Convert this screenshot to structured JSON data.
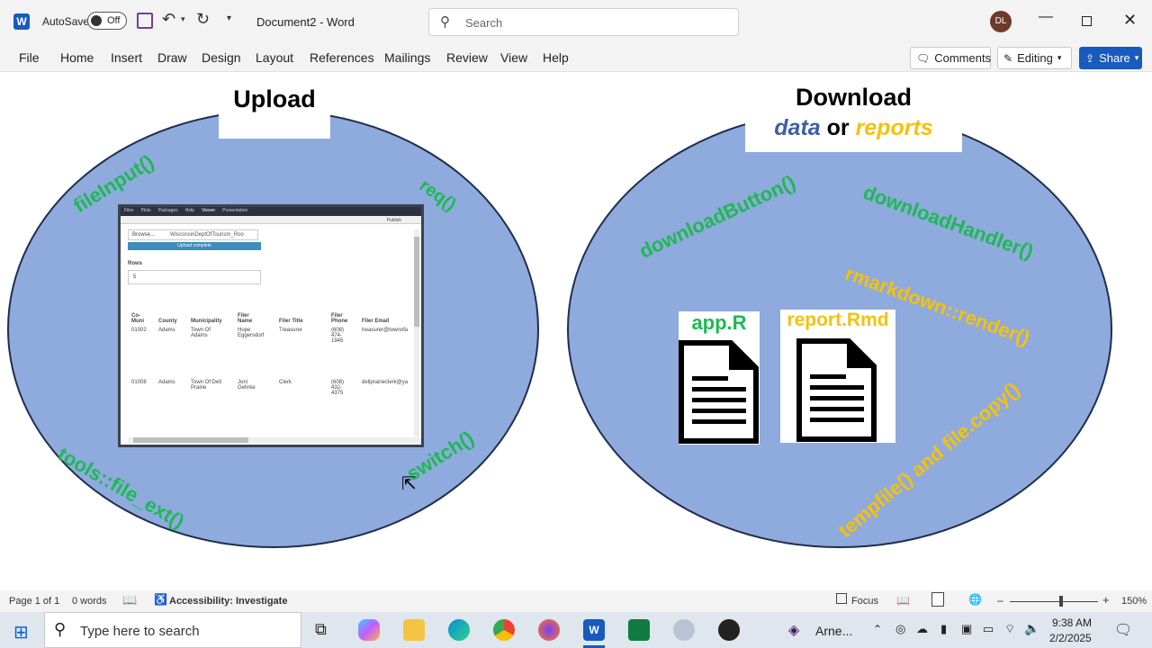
{
  "titlebar": {
    "app_badge": "W",
    "autosave_label": "AutoSave",
    "autosave_state": "Off",
    "doc_title": "Document2  -  Word",
    "search_placeholder": "Search",
    "user_initials": "DL"
  },
  "menu": {
    "items": [
      "File",
      "Home",
      "Insert",
      "Draw",
      "Design",
      "Layout",
      "References",
      "Mailings",
      "Review",
      "View",
      "Help"
    ],
    "comments_label": "Comments",
    "editing_label": "Editing",
    "share_label": "Share"
  },
  "slide": {
    "upload_title": "Upload",
    "download_title": "Download",
    "download_sub_data": "data",
    "download_sub_or": "or",
    "download_sub_reports": "reports",
    "upload_funcs": [
      "fileInput()",
      "req()",
      "tools::file_ext()",
      "switch()"
    ],
    "download_funcs": [
      "downloadButton()",
      "downloadHandler()",
      "rmarkdown::render()",
      "tempfile() and file.copy()"
    ],
    "file1_label": "app.R",
    "file2_label": "report.Rmd",
    "colors": {
      "green": "#1db954",
      "yellow": "#f4c20d",
      "ellipse_fill": "#8faadc",
      "data_blue": "#3b5ea8"
    }
  },
  "mini_app": {
    "tabs": [
      "Files",
      "Plots",
      "Packages",
      "Help",
      "Viewer",
      "Presentation"
    ],
    "publish_label": "Publish",
    "browse_label": "Browse...",
    "file_name": "WisconsinDeptOfTourism_Roo",
    "progress_label": "Upload complete",
    "progress_fraction": 1.0,
    "rows_label": "Rows",
    "rows_value": "5",
    "headers": [
      "Co-\nMuni",
      "County",
      "Municipality",
      "Filer\nName",
      "Filer Title",
      "Filer\nPhone",
      "Filer Email"
    ],
    "rows": [
      [
        "01002",
        "Adams",
        "Town Of\nAdams",
        "Hope\nEggersdorf",
        "Treasurer",
        "(608)\n474-\n1945",
        "treasurer@townofa"
      ],
      [
        "01008",
        "Adams",
        "Town Of Dell\nPraine",
        "Joni\nGehrke",
        "Clerk",
        "(608)\n432-\n4375",
        "dellprairieclerk@ya"
      ]
    ]
  },
  "status": {
    "page": "Page 1 of 1",
    "words": "0 words",
    "accessibility": "Accessibility: Investigate",
    "focus": "Focus",
    "zoom_minus": "–",
    "zoom_plus": "+",
    "zoom": "150%"
  },
  "taskbar": {
    "search_placeholder": "Type here to search",
    "news": "Arne...",
    "time": "9:38 AM",
    "date": "2/2/2025"
  }
}
